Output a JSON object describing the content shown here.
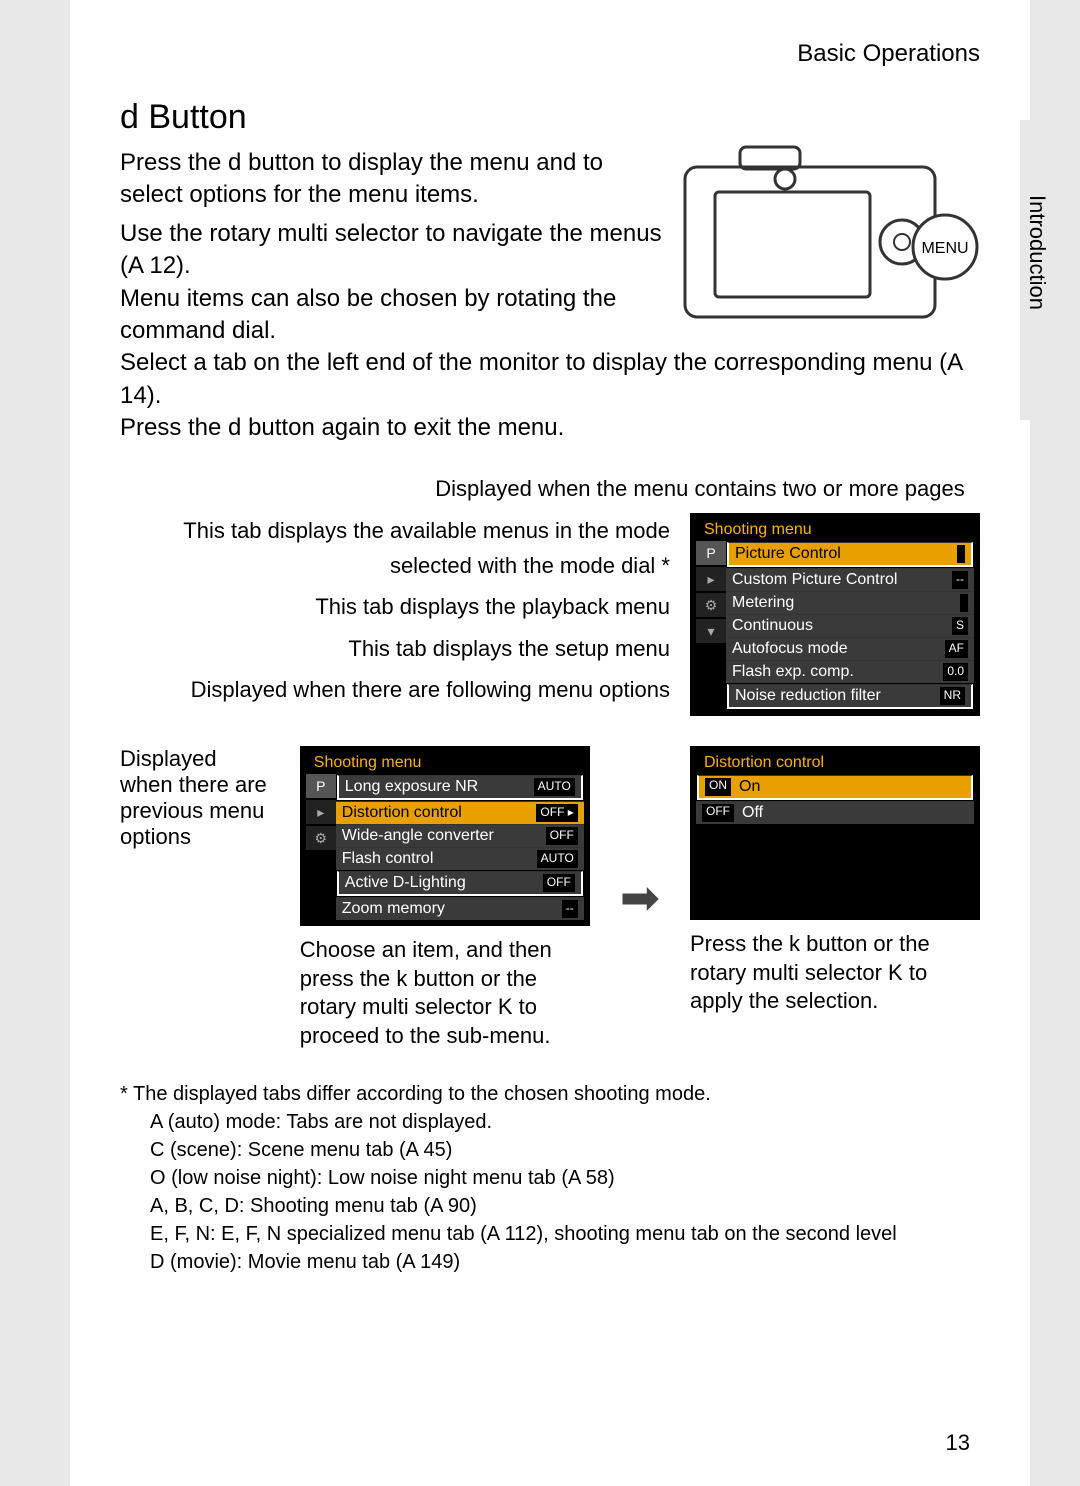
{
  "header": {
    "section": "Basic Operations"
  },
  "side_label": "Introduction",
  "title": "d Button",
  "intro": "Press the d button to display the menu and to select options for the menu items.",
  "bullets": [
    "Use the rotary multi selector to navigate the menus (A 12).",
    "Menu items can also be chosen by rotating the command dial.",
    "Select a tab on the left end of the monitor to display the corresponding menu (A 14).",
    "Press the d button again to exit the menu."
  ],
  "caption_top": "Displayed when the menu contains two or more pages",
  "left_labels": {
    "l1": "This tab displays the available menus in the mode selected with the mode dial *",
    "l2": "This tab displays the playback menu",
    "l3": "This tab displays the setup menu",
    "l4": "Displayed when there are following menu options"
  },
  "menu1": {
    "title": "Shooting menu",
    "tab_sel": "P",
    "items": [
      {
        "label": "Picture Control",
        "val": ""
      },
      {
        "label": "Custom Picture Control",
        "val": "--"
      },
      {
        "label": "Metering",
        "val": ""
      },
      {
        "label": "Continuous",
        "val": "S"
      },
      {
        "label": "Autofocus mode",
        "val": "AF"
      },
      {
        "label": "Flash exp. comp.",
        "val": "0.0"
      },
      {
        "label": "Noise reduction filter",
        "val": "NR"
      }
    ]
  },
  "prev_label": "Displayed when there are previous menu options",
  "menu2": {
    "title": "Shooting menu",
    "tab_sel": "P",
    "items": [
      {
        "label": "Long exposure NR",
        "val": "AUTO"
      },
      {
        "label": "Distortion control",
        "val": "OFF ▸",
        "sel": true
      },
      {
        "label": "Wide-angle converter",
        "val": "OFF"
      },
      {
        "label": "Flash control",
        "val": "AUTO"
      },
      {
        "label": "Active D-Lighting",
        "val": "OFF"
      },
      {
        "label": "Zoom memory",
        "val": "--"
      }
    ]
  },
  "menu3": {
    "title": "Distortion control",
    "items": [
      {
        "label": "On",
        "val": "",
        "sel": true,
        "icon": "ON"
      },
      {
        "label": "Off",
        "val": "",
        "icon": "OFF"
      }
    ]
  },
  "cap_left": "Choose an item, and then press the k button or the rotary multi selector K to proceed to the sub-menu.",
  "cap_right": "Press the k button or the rotary multi selector K to apply the selection.",
  "footnote_lead": "* The displayed tabs differ according to the chosen shooting mode.",
  "footnotes": [
    "A (auto) mode: Tabs are not displayed.",
    "C (scene): Scene menu tab (A 45)",
    "O (low noise night): Low noise night menu tab (A 58)",
    "A, B, C, D: Shooting menu tab (A 90)",
    "E, F, N: E, F, N specialized menu tab (A 112), shooting menu tab on the second level",
    "D (movie): Movie menu tab (A 149)"
  ],
  "page_number": "13",
  "menu_btn": "MENU"
}
